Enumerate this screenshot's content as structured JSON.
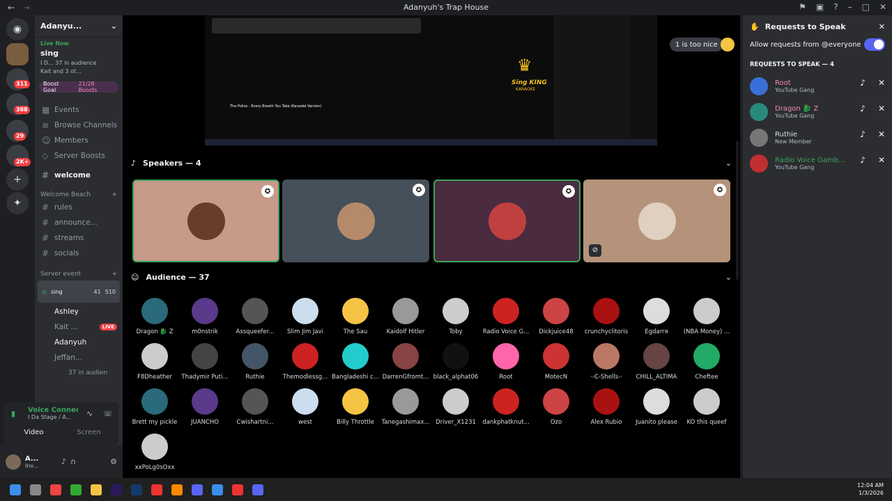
{
  "window": {
    "title": "Adanyuh's Trap House"
  },
  "servers": {
    "badges": [
      "311",
      "388",
      "29",
      "2K+"
    ]
  },
  "sidebar": {
    "guild_name": "Adanyu...",
    "live_label": "Live Now",
    "live_channel": "sing",
    "live_meta": "I D...  37 in audience",
    "live_users": "Kait   and 3 ot...",
    "boost_goal": "Boost Goal",
    "boost_count": "21/28 Boosts",
    "nav": [
      "Events",
      "Browse Channels",
      "Members",
      "Server Boosts"
    ],
    "welcome": "welcome",
    "category1": "Welcome Beach",
    "channels": [
      "rules",
      "announce...",
      "streams",
      "socials"
    ],
    "category2": "Server event",
    "stage": {
      "name": "sing",
      "viewers": "41",
      "count": "510"
    },
    "stage_users": [
      "Ashley",
      "Kait ...",
      "Adanyuh",
      "Jeffan..."
    ],
    "live_badge": "LIVE",
    "audience_line": "37 in audien",
    "voice_connected": "Voice Connecte",
    "voice_sub": "I Da Stage / A...",
    "video": "Video",
    "screen": "Screen",
    "user": {
      "name": "A...",
      "status": "Inv..."
    }
  },
  "stream": {
    "title": "The Police - Every Breath You Take (Karaoke Version)",
    "brand": "Sing KING",
    "brand2": "KARAOKE",
    "reaction": "1 is too nice"
  },
  "speakers": {
    "header": "Speakers — 4"
  },
  "audience": {
    "header": "Audience — 37",
    "members": [
      "Dragon 🐉 Z",
      "m0nstrik",
      "Assqueefer...",
      "Slim Jim Javi",
      "The Sau",
      "Kaidolf Hitler",
      "Toby",
      "Radio Voice G...",
      "Dickjuice48",
      "crunchyclitoris",
      "Egdarrя",
      "(NBA Money) ...",
      "F8Dheather",
      "Thadymir Puti...",
      "Ruthie",
      "Themodlessg...",
      "Bangladeshi c...",
      "DarrenGfromt...",
      "black_alphat06",
      "Root",
      "MotecN",
      "·-Ͼ-Shells-·",
      "CHILL_ALTIMA",
      "Cheftee",
      "Brett my pickle",
      "JUANCHO",
      "Cwishartni...",
      "west",
      "Billy Throttle",
      "Tanegashimax...",
      "Driver_X1231",
      "dankphatknut...",
      "Ozo",
      "Alex Rubio",
      "Juanito please",
      "KO this queef",
      "xxPoLg0sOxx"
    ]
  },
  "requests": {
    "title": "Requests to Speak",
    "allow": "Allow requests from @everyone",
    "header": "REQUESTS TO SPEAK — 4",
    "items": [
      {
        "name": "Root",
        "sub": "YouTube Gang",
        "color": "#f28ab8"
      },
      {
        "name": "Dragon 🐉 Z",
        "sub": "YouTube Gang",
        "color": "#f28ab8"
      },
      {
        "name": "Ruthie",
        "sub": "New Member",
        "color": "#dbdee1"
      },
      {
        "name": "Radio Voice Gamb...",
        "sub": "YouTube Gang",
        "color": "#3ba55c"
      }
    ]
  },
  "taskbar": {
    "time": "12:04 AM",
    "date": "1/3/2026"
  }
}
